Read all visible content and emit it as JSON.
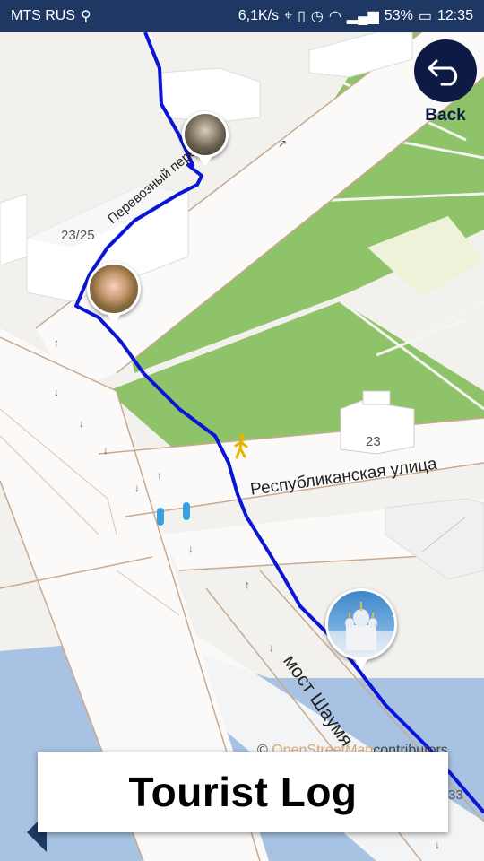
{
  "status_bar": {
    "carrier": "MTS RUS",
    "speed": "6,1K/s",
    "battery": "53%",
    "time": "12:35"
  },
  "map": {
    "street_1": "Перевозный переулок",
    "street_2": "Республиканская улица",
    "bridge": "мост Шаумя",
    "building_1": "23/25",
    "building_2": "23",
    "building_3": "33",
    "attribution_prefix": "©",
    "attribution_link": "OpenStreetMap",
    "attribution_suffix": "contributors",
    "route_color": "#0b16d4",
    "park_color": "#8fc36a",
    "water_color": "#a7c2e2"
  },
  "back_button": {
    "label": "Back",
    "icon": "undo-arrow-icon"
  },
  "banner": {
    "title": "Tourist Log"
  }
}
